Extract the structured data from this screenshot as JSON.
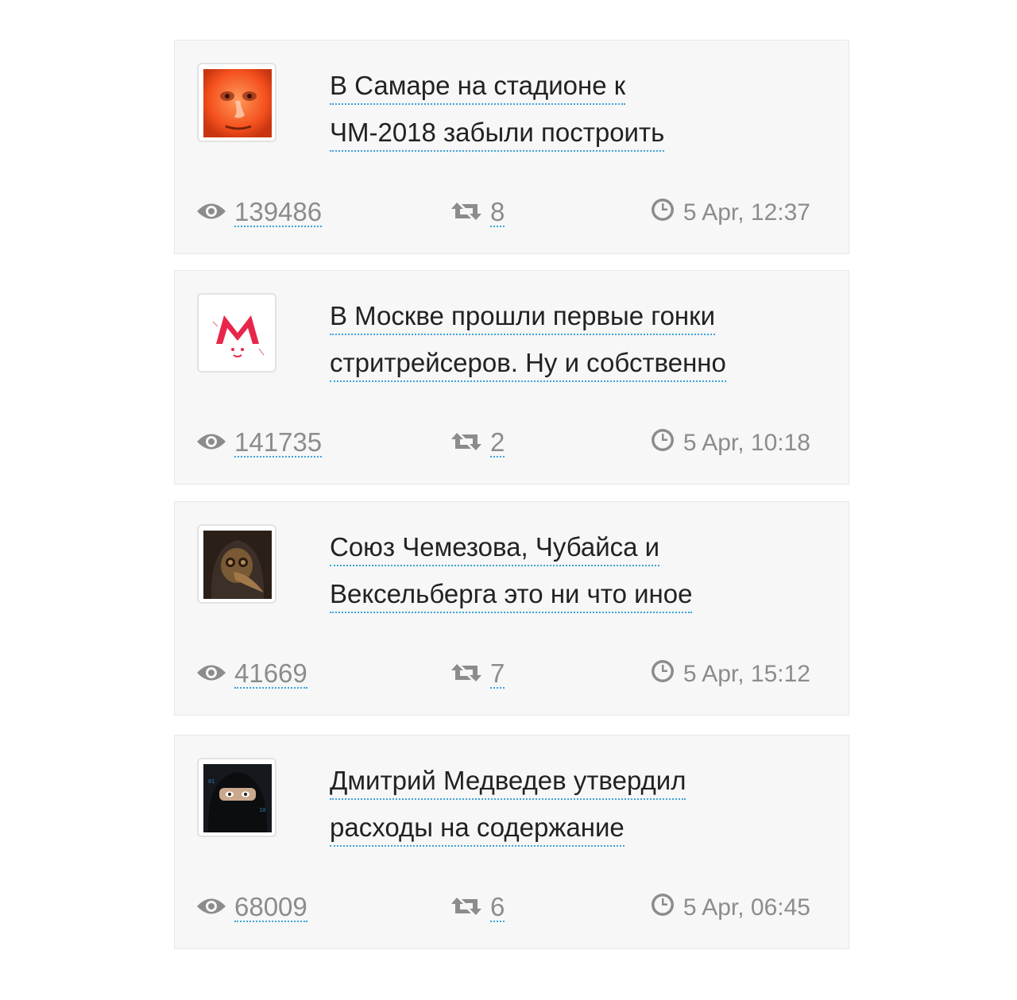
{
  "posts": [
    {
      "title_lines": [
        "В Самаре на стадионе к",
        "ЧМ-2018 забыли построить"
      ],
      "views": "139486",
      "reposts": "8",
      "time": "5 Apr, 12:37",
      "avatar_icon": "photo-avatar-red-face"
    },
    {
      "title_lines": [
        "В Москве прошли первые гонки",
        "стритрейсеров. Ну и собственно"
      ],
      "views": "141735",
      "reposts": "2",
      "time": "5 Apr, 10:18",
      "avatar_icon": "m-logo-avatar"
    },
    {
      "title_lines": [
        "Союз Чемезова, Чубайса и",
        "Вексельберга это ни что иное"
      ],
      "views": "41669",
      "reposts": "7",
      "time": "5 Apr, 15:12",
      "avatar_icon": "plague-doctor-avatar"
    },
    {
      "title_lines": [
        "Дмитрий Медведев утвердил",
        "расходы на содержание"
      ],
      "views": "68009",
      "reposts": "6",
      "time": "5 Apr, 06:45",
      "avatar_icon": "masked-person-avatar"
    }
  ],
  "colors": {
    "link_underline": "#3aa3dc",
    "meta_text": "#8c8c8c",
    "title_text": "#222222",
    "card_bg": "#f7f7f7"
  }
}
